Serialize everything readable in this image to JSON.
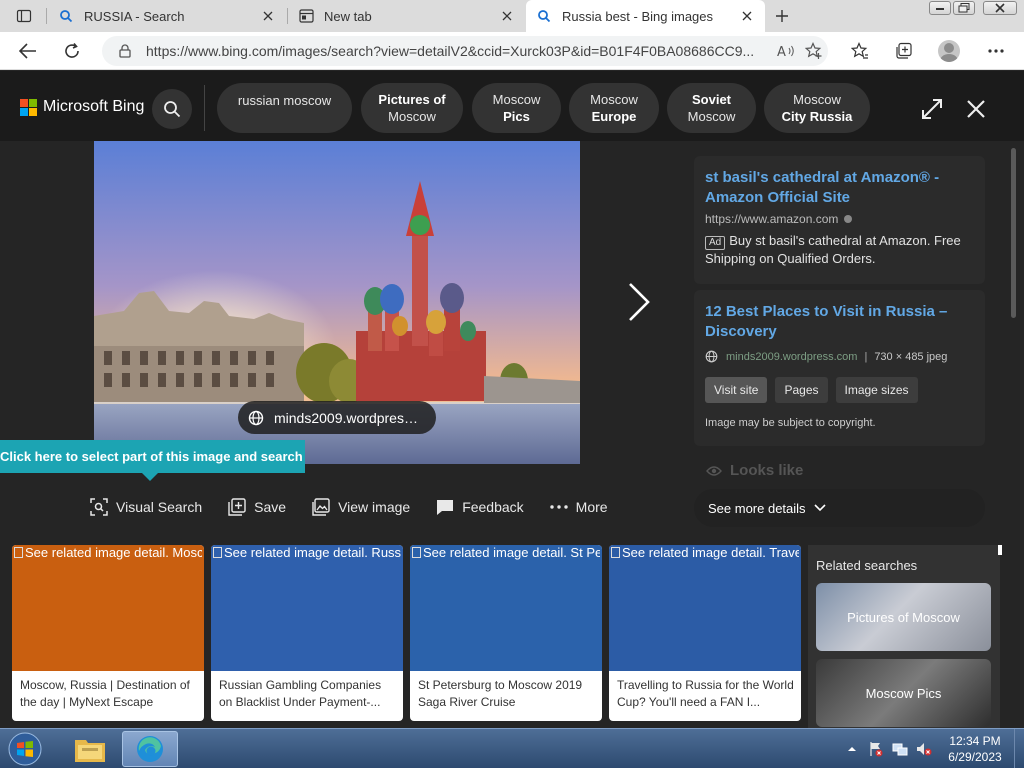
{
  "browser": {
    "tabs": [
      {
        "title": "RUSSIA - Search",
        "icon": "bing-search-icon",
        "active": false
      },
      {
        "title": "New tab",
        "icon": "new-tab-page-icon",
        "active": false
      },
      {
        "title": "Russia best - Bing images",
        "icon": "bing-search-icon",
        "active": true
      }
    ],
    "url": "https://www.bing.com/images/search?view=detailV2&ccid=Xurck03P&id=B01F4F0BA08686CC9..."
  },
  "header": {
    "logo_text": "Microsoft Bing",
    "chips": [
      {
        "line1": "russian moscow",
        "line2": ""
      },
      {
        "line1": "Pictures of",
        "line2": "Moscow"
      },
      {
        "line1": "Moscow",
        "line2": "Pics"
      },
      {
        "line1": "Moscow",
        "line2": "Europe"
      },
      {
        "line1": "Soviet",
        "line2": "Moscow"
      },
      {
        "line1": "Moscow",
        "line2": "City Russia"
      }
    ]
  },
  "viewer": {
    "source_pill": "minds2009.wordpress....",
    "visual_search_tip": "Click here to select part of this image and search it",
    "actions": {
      "visual_search": "Visual Search",
      "save": "Save",
      "view_image": "View image",
      "feedback": "Feedback",
      "more": "More"
    }
  },
  "side_panel": {
    "ad": {
      "title": "st basil's cathedral at Amazon® - Amazon Official Site",
      "url": "https://www.amazon.com",
      "badge": "Ad",
      "description": "Buy st basil's cathedral at Amazon. Free Shipping on Qualified Orders."
    },
    "result": {
      "title": "12 Best Places to Visit in Russia – Discovery",
      "domain": "minds2009.wordpress.com",
      "separator": "|",
      "dimensions": "730 × 485 jpeg",
      "buttons": {
        "visit_site": "Visit site",
        "pages": "Pages",
        "image_sizes": "Image sizes"
      },
      "copyright": "Image may be subject to copyright."
    },
    "looks_like": "Looks like",
    "see_more": "See more details"
  },
  "related_images": [
    {
      "alt": "See related image detail. Moscow, Russia",
      "caption": "Moscow, Russia | Destination of the day | MyNext Escape",
      "color": "#c95f10"
    },
    {
      "alt": "See related image detail. Russian Gambling",
      "caption": "Russian Gambling Companies on Blacklist Under Payment-...",
      "color": "#2f60ad"
    },
    {
      "alt": "See related image detail. St Petersburg",
      "caption": "St Petersburg to Moscow 2019 Saga River Cruise",
      "color": "#2b62ab"
    },
    {
      "alt": "See related image detail. Travelling",
      "caption": "Travelling to Russia for the World Cup? You'll need a FAN I...",
      "color": "#2c5ca6"
    }
  ],
  "related_searches": {
    "title": "Related searches",
    "items": [
      {
        "label": "Pictures of Moscow"
      },
      {
        "label": "Moscow Pics"
      }
    ]
  },
  "taskbar": {
    "time": "12:34 PM",
    "date": "6/29/2023"
  },
  "colors": {
    "bing_bg": "#1b1b1b",
    "link_blue": "#62a8e5",
    "tip_teal": "#1ca4b3",
    "ms_red": "#f25022",
    "ms_green": "#7fba00",
    "ms_blue": "#00a4ef",
    "ms_yellow": "#ffb900"
  }
}
